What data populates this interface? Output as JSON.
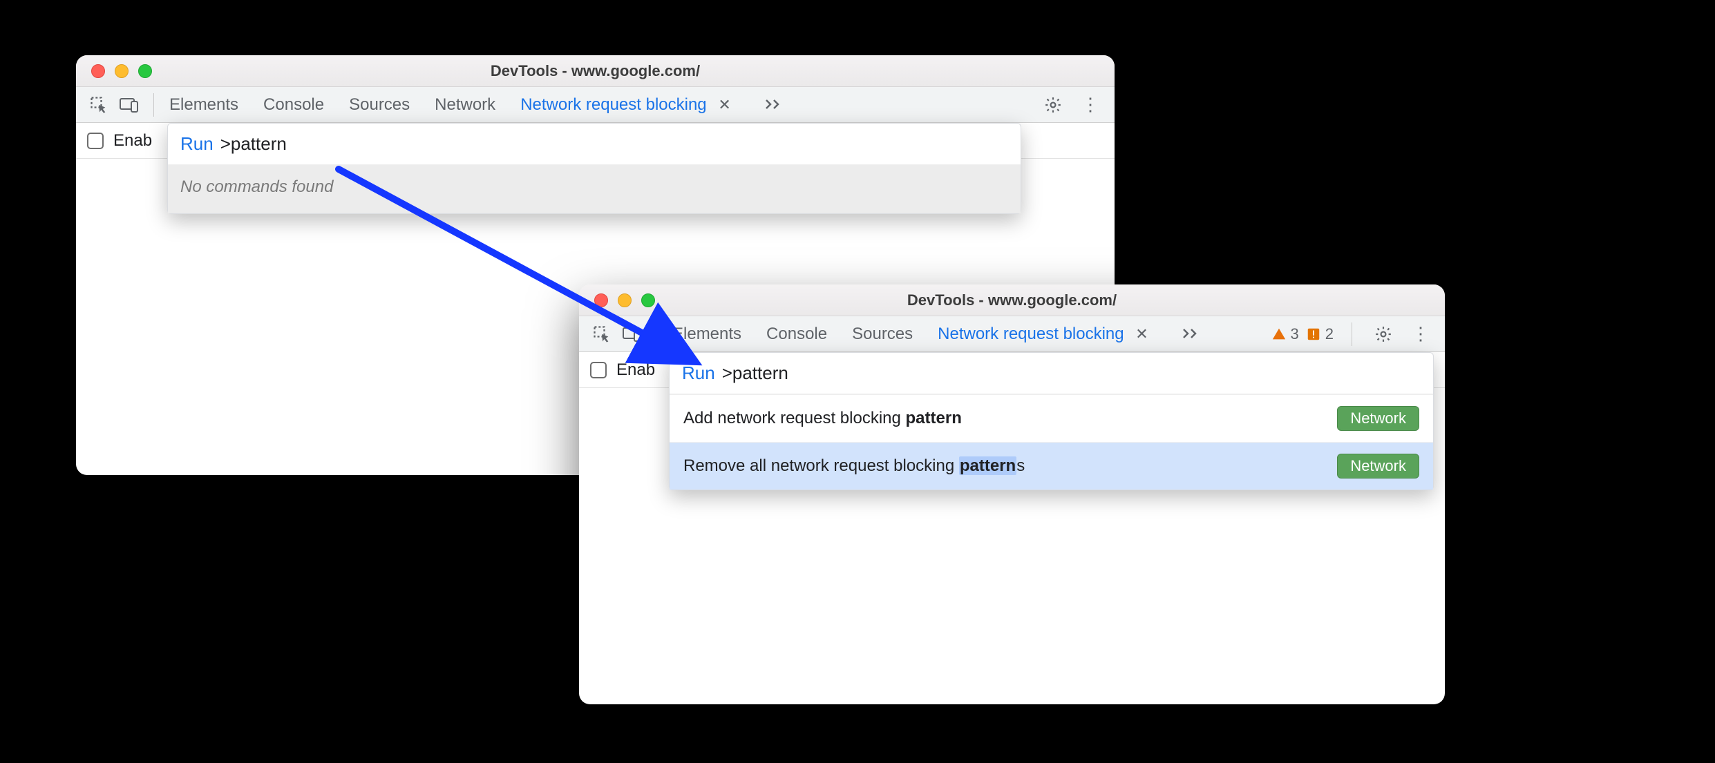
{
  "windows": {
    "a": {
      "title": "DevTools - www.google.com/",
      "tabs": {
        "elements": "Elements",
        "console": "Console",
        "sources": "Sources",
        "network": "Network",
        "nrb": "Network request blocking"
      },
      "enable_label": "Enab",
      "palette": {
        "run_label": "Run",
        "query": ">pattern",
        "empty": "No commands found"
      }
    },
    "b": {
      "title": "DevTools - www.google.com/",
      "tabs": {
        "elements": "Elements",
        "console": "Console",
        "sources": "Sources",
        "nrb": "Network request blocking"
      },
      "enable_label": "Enab",
      "warnings": "3",
      "infos": "2",
      "palette": {
        "run_label": "Run",
        "query": ">pattern",
        "items": [
          {
            "prefix": "Add network request blocking ",
            "match": "pattern",
            "suffix": "",
            "badge": "Network"
          },
          {
            "prefix": "Remove all network request blocking ",
            "match": "pattern",
            "suffix": "s",
            "badge": "Network"
          }
        ]
      }
    }
  }
}
